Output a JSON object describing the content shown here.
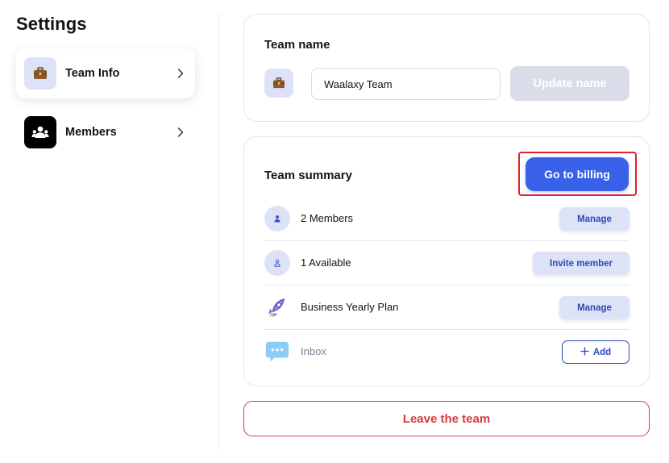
{
  "sidebar": {
    "title": "Settings",
    "items": [
      {
        "label": "Team Info",
        "icon": "briefcase-icon",
        "active": true
      },
      {
        "label": "Members",
        "icon": "people-icon",
        "active": false
      }
    ]
  },
  "team_name_card": {
    "title": "Team name",
    "input_value": "Waalaxy Team",
    "update_button": "Update name"
  },
  "team_summary_card": {
    "title": "Team summary",
    "billing_button": "Go to billing",
    "rows": [
      {
        "label": "2 Members",
        "action": "Manage",
        "icon": "person-icon"
      },
      {
        "label": "1 Available",
        "action": "Invite member",
        "icon": "person-outline-icon"
      },
      {
        "label": "Business Yearly Plan",
        "action": "Manage",
        "icon": "rocket-icon"
      },
      {
        "label": "Inbox",
        "action": "Add",
        "icon": "chat-bubble-icon"
      }
    ]
  },
  "leave_button": "Leave the team",
  "colors": {
    "primary": "#3860e8",
    "soft_blue": "#dde2f7",
    "danger": "#d73b3e",
    "highlight_red": "#e0202e"
  }
}
